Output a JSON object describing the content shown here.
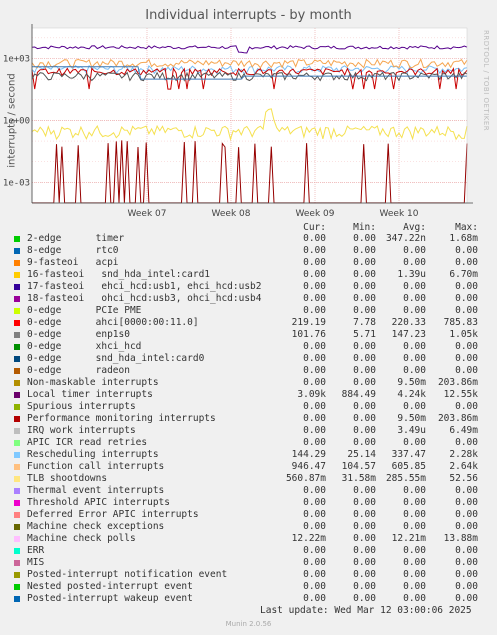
{
  "title": "Individual interrupts - by month",
  "side_caption": "RRDTOOL / TOBI OETIKER",
  "chart_data": {
    "type": "line",
    "title": "Individual interrupts - by month",
    "ylabel": "interrupts / second",
    "yscale": "log",
    "ylim": [
      0.0001,
      30000
    ],
    "yticks": [
      "1e+03",
      "1e+00",
      "1e-03"
    ],
    "xticks": [
      "Week 07",
      "Week 08",
      "Week 09",
      "Week 10"
    ],
    "grid": true,
    "series": [
      {
        "name": "Local timer interrupts",
        "color": "#55008c",
        "level": 3200,
        "pattern": "flat-high"
      },
      {
        "name": "Rescheduling interrupts",
        "color": "#7abef5",
        "level": 300,
        "pattern": "noisy"
      },
      {
        "name": "Function call interrupts",
        "color": "#f5a550",
        "level": 600,
        "pattern": "noisy"
      },
      {
        "name": "ahci[0000:00:11.0]",
        "color": "#c80000",
        "level": 220,
        "pattern": "noisy-dips"
      },
      {
        "name": "enp1s0",
        "color": "#555555",
        "level": 140,
        "pattern": "noisy"
      },
      {
        "name": "9-fasteoi acpi",
        "color": "#3c78b4",
        "level": 200,
        "pattern": "step"
      },
      {
        "name": "TLB shootdowns",
        "color": "#f5e150",
        "level": 0.3,
        "pattern": "noisy-low"
      },
      {
        "name": "Non-maskable interrupts",
        "color": "#960000",
        "level": 0.01,
        "pattern": "spikes"
      }
    ]
  },
  "legend": {
    "headers": {
      "cur": "Cur:",
      "min": "Min:",
      "avg": "Avg:",
      "max": "Max:"
    },
    "rows": [
      {
        "name": "2-edge      timer",
        "color": "#00cc00",
        "cur": "0.00",
        "min": "0.00",
        "avg": "347.22n",
        "max": "1.68m"
      },
      {
        "name": "8-edge      rtc0",
        "color": "#0066b3",
        "cur": "0.00",
        "min": "0.00",
        "avg": "0.00",
        "max": "0.00"
      },
      {
        "name": "9-fasteoi   acpi",
        "color": "#ff8000",
        "cur": "0.00",
        "min": "0.00",
        "avg": "0.00",
        "max": "0.00"
      },
      {
        "name": "16-fasteoi   snd_hda_intel:card1",
        "color": "#ffcc00",
        "cur": "0.00",
        "min": "0.00",
        "avg": "1.39u",
        "max": "6.70m"
      },
      {
        "name": "17-fasteoi   ehci_hcd:usb1, ehci_hcd:usb2",
        "color": "#330099",
        "cur": "0.00",
        "min": "0.00",
        "avg": "0.00",
        "max": "0.00"
      },
      {
        "name": "18-fasteoi   ohci_hcd:usb3, ohci_hcd:usb4",
        "color": "#990099",
        "cur": "0.00",
        "min": "0.00",
        "avg": "0.00",
        "max": "0.00"
      },
      {
        "name": "0-edge      PCIe PME",
        "color": "#ccff00",
        "cur": "0.00",
        "min": "0.00",
        "avg": "0.00",
        "max": "0.00"
      },
      {
        "name": "0-edge      ahci[0000:00:11.0]",
        "color": "#ff0000",
        "cur": "219.19",
        "min": "7.78",
        "avg": "220.33",
        "max": "785.83"
      },
      {
        "name": "0-edge      enp1s0",
        "color": "#808080",
        "cur": "101.76",
        "min": "5.71",
        "avg": "147.23",
        "max": "1.05k"
      },
      {
        "name": "0-edge      xhci_hcd",
        "color": "#008f00",
        "cur": "0.00",
        "min": "0.00",
        "avg": "0.00",
        "max": "0.00"
      },
      {
        "name": "0-edge      snd_hda_intel:card0",
        "color": "#00487d",
        "cur": "0.00",
        "min": "0.00",
        "avg": "0.00",
        "max": "0.00"
      },
      {
        "name": "0-edge      radeon",
        "color": "#b35a00",
        "cur": "0.00",
        "min": "0.00",
        "avg": "0.00",
        "max": "0.00"
      },
      {
        "name": "Non-maskable interrupts",
        "color": "#b38f00",
        "cur": "0.00",
        "min": "0.00",
        "avg": "9.50m",
        "max": "203.86m"
      },
      {
        "name": "Local timer interrupts",
        "color": "#6b006b",
        "cur": "3.09k",
        "min": "884.49",
        "avg": "4.24k",
        "max": "12.55k"
      },
      {
        "name": "Spurious interrupts",
        "color": "#8fb300",
        "cur": "0.00",
        "min": "0.00",
        "avg": "0.00",
        "max": "0.00"
      },
      {
        "name": "Performance monitoring interrupts",
        "color": "#b30000",
        "cur": "0.00",
        "min": "0.00",
        "avg": "9.50m",
        "max": "203.86m"
      },
      {
        "name": "IRQ work interrupts",
        "color": "#bebebe",
        "cur": "0.00",
        "min": "0.00",
        "avg": "3.49u",
        "max": "6.49m"
      },
      {
        "name": "APIC ICR read retries",
        "color": "#80ff80",
        "cur": "0.00",
        "min": "0.00",
        "avg": "0.00",
        "max": "0.00"
      },
      {
        "name": "Rescheduling interrupts",
        "color": "#80c9ff",
        "cur": "144.29",
        "min": "25.14",
        "avg": "337.47",
        "max": "2.28k"
      },
      {
        "name": "Function call interrupts",
        "color": "#ffc080",
        "cur": "946.47",
        "min": "104.57",
        "avg": "605.85",
        "max": "2.64k"
      },
      {
        "name": "TLB shootdowns",
        "color": "#ffe680",
        "cur": "560.87m",
        "min": "31.58m",
        "avg": "285.55m",
        "max": "52.56"
      },
      {
        "name": "Thermal event interrupts",
        "color": "#aa80ff",
        "cur": "0.00",
        "min": "0.00",
        "avg": "0.00",
        "max": "0.00"
      },
      {
        "name": "Threshold APIC interrupts",
        "color": "#ee00cc",
        "cur": "0.00",
        "min": "0.00",
        "avg": "0.00",
        "max": "0.00"
      },
      {
        "name": "Deferred Error APIC interrupts",
        "color": "#ff8080",
        "cur": "0.00",
        "min": "0.00",
        "avg": "0.00",
        "max": "0.00"
      },
      {
        "name": "Machine check exceptions",
        "color": "#666600",
        "cur": "0.00",
        "min": "0.00",
        "avg": "0.00",
        "max": "0.00"
      },
      {
        "name": "Machine check polls",
        "color": "#ffbfff",
        "cur": "12.22m",
        "min": "0.00",
        "avg": "12.21m",
        "max": "13.88m"
      },
      {
        "name": "ERR",
        "color": "#00ffcc",
        "cur": "0.00",
        "min": "0.00",
        "avg": "0.00",
        "max": "0.00"
      },
      {
        "name": "MIS",
        "color": "#cc6699",
        "cur": "0.00",
        "min": "0.00",
        "avg": "0.00",
        "max": "0.00"
      },
      {
        "name": "Posted-interrupt notification event",
        "color": "#999900",
        "cur": "0.00",
        "min": "0.00",
        "avg": "0.00",
        "max": "0.00"
      },
      {
        "name": "Nested posted-interrupt event",
        "color": "#00cc00",
        "cur": "0.00",
        "min": "0.00",
        "avg": "0.00",
        "max": "0.00"
      },
      {
        "name": "Posted-interrupt wakeup event",
        "color": "#0066b3",
        "cur": "0.00",
        "min": "0.00",
        "avg": "0.00",
        "max": "0.00"
      }
    ]
  },
  "footer": "Last update: Wed Mar 12 03:00:06 2025",
  "munin": "Munin 2.0.56"
}
